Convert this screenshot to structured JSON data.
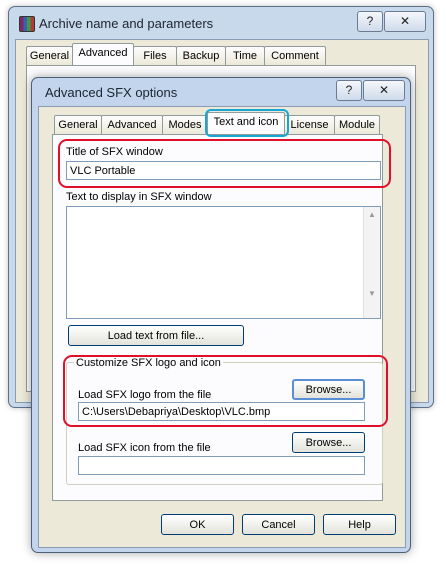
{
  "back_window": {
    "title": "Archive name and parameters",
    "help_btn": "?",
    "close_btn": "✕",
    "tabs": [
      "General",
      "Advanced",
      "Files",
      "Backup",
      "Time",
      "Comment"
    ]
  },
  "dialog": {
    "title": "Advanced SFX options",
    "help_btn": "?",
    "close_btn": "✕",
    "tabs": [
      "General",
      "Advanced",
      "Modes",
      "Text and icon",
      "License",
      "Module"
    ],
    "active_tab": "Text and icon",
    "title_label": "Title of SFX window",
    "title_value": "VLC Portable",
    "text_label": "Text to display in SFX window",
    "text_value": "",
    "load_text_button": "Load text from file...",
    "logo_group_label": "Customize SFX logo and icon",
    "logo_label": "Load SFX logo from the file",
    "logo_browse": "Browse...",
    "logo_path": "C:\\Users\\Debapriya\\Desktop\\VLC.bmp",
    "icon_label": "Load SFX icon from the file",
    "icon_browse": "Browse...",
    "icon_path": "",
    "ok": "OK",
    "cancel": "Cancel",
    "help": "Help"
  },
  "colors": {
    "highlight_red": "#e0102a",
    "highlight_cyan": "#16a7d6"
  }
}
